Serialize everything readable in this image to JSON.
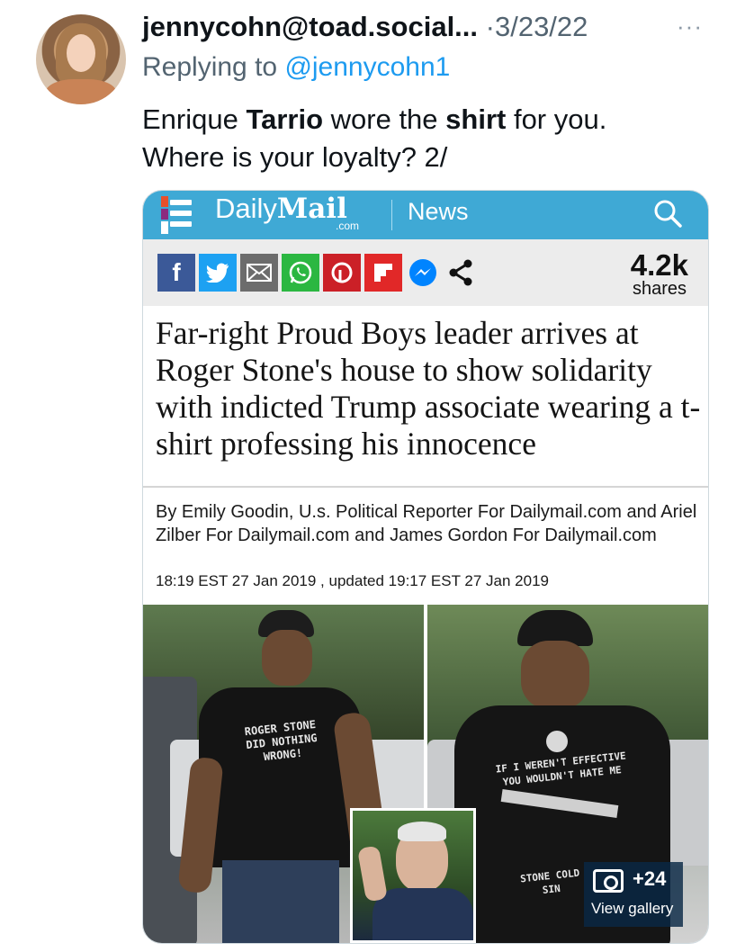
{
  "tweet": {
    "author": "jennycohn@toad.social...",
    "separator": "·",
    "date": "3/23/22",
    "more": "···",
    "replying_prefix": "Replying to",
    "replying_handle": "@jennycohn1",
    "text_parts": [
      "Enrique ",
      "Tarrio",
      " wore the ",
      "shirt",
      " for you.",
      "Where is your loyalty? 2/"
    ]
  },
  "article": {
    "site_daily": "Daily",
    "site_mail": "Mail",
    "site_com": ".com",
    "section": "News",
    "share_icons": [
      "facebook-icon",
      "twitter-icon",
      "email-icon",
      "whatsapp-icon",
      "pinterest-icon",
      "flipboard-icon",
      "messenger-icon",
      "share-icon"
    ],
    "share_count": "4.2k",
    "share_label": "shares",
    "headline": "Far-right Proud Boys leader arrives at Roger Stone's house to show solidarity with indicted Trump associate wearing a t-shirt professing his innocence",
    "byline": "By Emily Goodin, U.s. Political Reporter For Dailymail.com and Ariel Zilber For Dailymail.com and James Gordon For Dailymail.com",
    "dateline": "18:19 EST 27 Jan 2019 , updated 19:17 EST 27 Jan 2019",
    "shirt_left": "ROGER STONE\nDID NOTHING\nWRONG!",
    "shirt_right": "IF I WEREN'T EFFECTIVE\nYOU WOULDN'T HATE ME",
    "shirt_right_bottom": "STONE COLD SIN",
    "gallery_count": "+24",
    "gallery_label": "View gallery"
  },
  "colors": {
    "link": "#1d9bf0",
    "muted": "#536471",
    "dailymail_blue": "#3fa9d5"
  }
}
